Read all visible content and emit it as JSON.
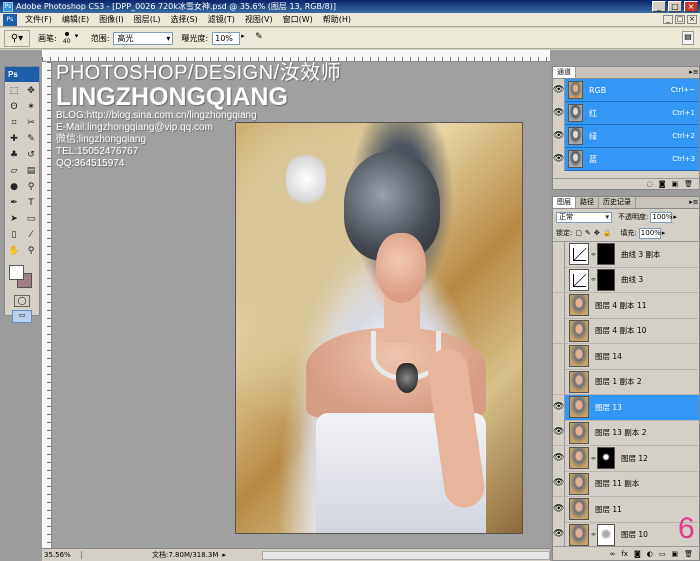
{
  "title": "Adobe Photoshop CS3 - [DPP_0026 720k冰雪女神.psd @ 35.6% (图层 13, RGB/8)]",
  "menu": [
    "文件(F)",
    "编辑(E)",
    "图像(I)",
    "图层(L)",
    "选择(S)",
    "滤镜(T)",
    "视图(V)",
    "窗口(W)",
    "帮助(H)"
  ],
  "options": {
    "brush_label": "画笔:",
    "brush_size": "40",
    "range_label": "范围:",
    "range_value": "高光",
    "exposure_label": "曝光度:",
    "exposure_value": "10%"
  },
  "toolbox": {
    "logo": "Ps",
    "foreground_color": "#ffffff",
    "background_color": "#9e7f84"
  },
  "watermark": {
    "line1": "PHOTOSHOP/DESIGN/汝效师",
    "line2": "LINGZHONGQIANG",
    "blog": "BLOG:http://blog.sina.com.cn/lingzhongqiang",
    "email": "E-Mail:lingzhongqiang@vip.qq.com",
    "wechat": "微信:lingzhongqiang",
    "tel": "TEL:15052476767",
    "qq": "QQ:364515974"
  },
  "status": {
    "zoom": "35.56%",
    "doc": "文档:7.80M/318.3M"
  },
  "channels": {
    "tab": "通道",
    "rows": [
      {
        "name": "RGB",
        "shortcut": "Ctrl+~"
      },
      {
        "name": "红",
        "shortcut": "Ctrl+1"
      },
      {
        "name": "绿",
        "shortcut": "Ctrl+2"
      },
      {
        "name": "蓝",
        "shortcut": "Ctrl+3"
      }
    ]
  },
  "layers_panel": {
    "tabs": [
      "图层",
      "路径",
      "历史记录"
    ],
    "blend_mode": "正常",
    "opacity_label": "不透明度:",
    "opacity": "100%",
    "lock_label": "锁定:",
    "fill_label": "填充:",
    "fill": "100%",
    "layers": [
      {
        "name": "曲线 3 副本",
        "visible": false,
        "type": "curves",
        "mask": "dark"
      },
      {
        "name": "曲线 3",
        "visible": false,
        "type": "curves",
        "mask": "dark"
      },
      {
        "name": "图层 4 副本 11",
        "visible": false,
        "type": "image"
      },
      {
        "name": "图层 4 副本 10",
        "visible": false,
        "type": "image"
      },
      {
        "name": "图层 14",
        "visible": false,
        "type": "image"
      },
      {
        "name": "图层 1 副本 2",
        "visible": false,
        "type": "image"
      },
      {
        "name": "图层 13",
        "visible": true,
        "type": "image",
        "selected": true
      },
      {
        "name": "图层 13 副本 2",
        "visible": true,
        "type": "image"
      },
      {
        "name": "图层 12",
        "visible": true,
        "type": "image-mask",
        "mask": "face"
      },
      {
        "name": "图层 11 副本",
        "visible": true,
        "type": "image"
      },
      {
        "name": "图层 11",
        "visible": true,
        "type": "image"
      },
      {
        "name": "图层 10",
        "visible": true,
        "type": "image-mask",
        "mask": "light"
      }
    ]
  },
  "step_number": "6",
  "step_color": "#e8388c"
}
